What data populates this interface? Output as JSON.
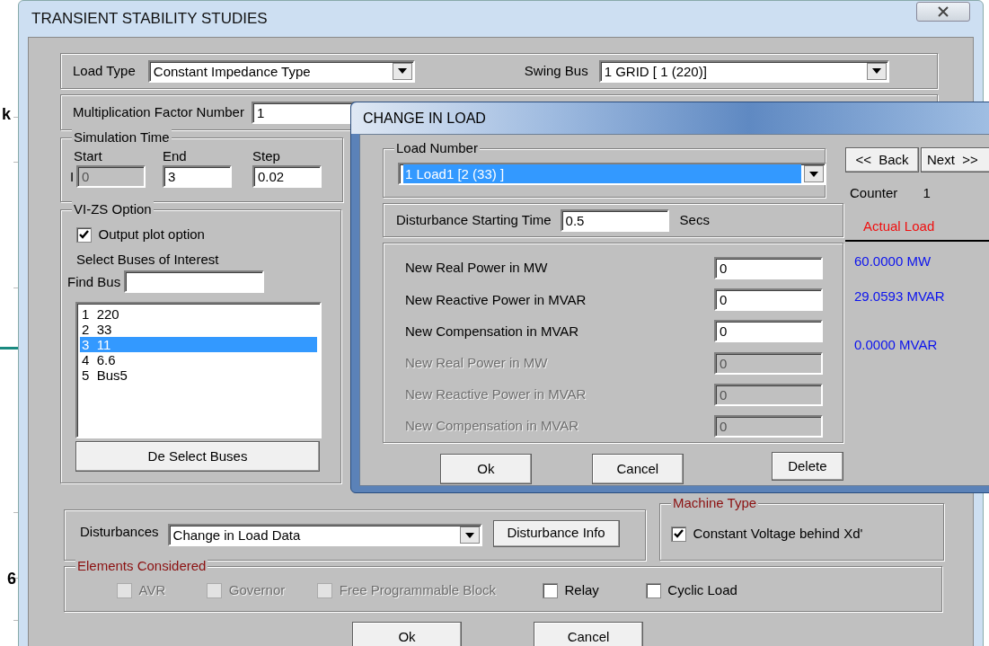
{
  "background": {
    "fragments": [
      "k",
      "6"
    ]
  },
  "window": {
    "title": "TRANSIENT STABILITY STUDIES"
  },
  "load_type": {
    "label": "Load Type",
    "value": "Constant Impedance Type"
  },
  "swing_bus": {
    "label": "Swing Bus",
    "value": "1 GRID [ 1 (220)]"
  },
  "multiplication_factor": {
    "label": "Multiplication Factor Number",
    "value": "1"
  },
  "simulation_time": {
    "title": "Simulation Time",
    "row_label": "I",
    "fields": [
      {
        "label": "Start",
        "value": "0",
        "disabled": true
      },
      {
        "label": "End",
        "value": "3",
        "disabled": false
      },
      {
        "label": "Step",
        "value": "0.02",
        "disabled": false
      }
    ]
  },
  "vi_zs_option": {
    "title": "VI-ZS Option",
    "output_plot": {
      "label": "Output plot option",
      "checked": true
    },
    "select_label": "Select Buses of Interest",
    "find_bus_label": "Find Bus",
    "buses": [
      {
        "label": "1  220",
        "selected": false
      },
      {
        "label": "2  33",
        "selected": false
      },
      {
        "label": "3  11",
        "selected": true
      },
      {
        "label": "4  6.6",
        "selected": false
      },
      {
        "label": "5  Bus5",
        "selected": false
      }
    ],
    "deselect_button": "De Select Buses"
  },
  "disturbances": {
    "label": "Disturbances",
    "value": "Change in Load Data",
    "info_button": "Disturbance Info"
  },
  "machine_type": {
    "title": "Machine Type",
    "option": {
      "label": "Constant Voltage  behind Xd'",
      "checked": true
    }
  },
  "elements_considered": {
    "title": "Elements  Considered",
    "items": [
      {
        "label": "AVR",
        "checked": false,
        "disabled": true
      },
      {
        "label": "Governor",
        "checked": false,
        "disabled": true
      },
      {
        "label": "Free Programmable Block",
        "checked": false,
        "disabled": true
      },
      {
        "label": "Relay",
        "checked": false,
        "disabled": false
      },
      {
        "label": "Cyclic Load",
        "checked": false,
        "disabled": false
      }
    ]
  },
  "buttons": [
    "Ok",
    "Cancel"
  ],
  "dialog": {
    "title": "CHANGE IN LOAD",
    "load_number": {
      "title": "Load Number",
      "value": "1 Load1 [2 (33) ]"
    },
    "starting_time": {
      "label": "Disturbance Starting Time",
      "value": "0.5",
      "unit": "Secs"
    },
    "fields": [
      {
        "label": "New Real Power in MW",
        "value": "0",
        "disabled": false
      },
      {
        "label": "New Reactive Power in MVAR",
        "value": "0",
        "disabled": false
      },
      {
        "label": "New Compensation in MVAR",
        "value": "0",
        "disabled": false
      },
      {
        "label": "New Real Power in MW",
        "value": "0",
        "disabled": true
      },
      {
        "label": "New Reactive Power in MVAR",
        "value": "0",
        "disabled": true
      },
      {
        "label": "New Compensation in MVAR",
        "value": "0",
        "disabled": true
      }
    ],
    "nav_buttons": [
      "<<  Back",
      "Next  >>"
    ],
    "counter": {
      "label": "Counter",
      "value": "1"
    },
    "actual_load": {
      "title": "Actual Load",
      "values": [
        "60.0000 MW",
        "29.0593 MVAR",
        "0.0000 MVAR"
      ]
    },
    "buttons": [
      "Ok",
      "Cancel",
      "Delete"
    ]
  }
}
